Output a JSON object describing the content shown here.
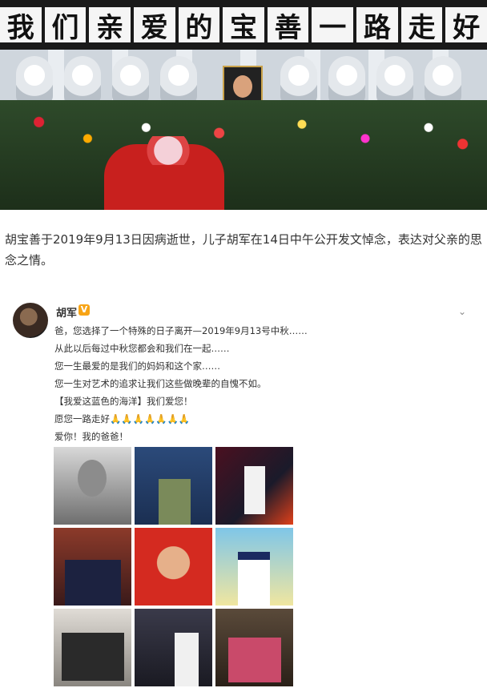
{
  "banner": {
    "chars": [
      "我",
      "们",
      "亲",
      "爱",
      "的",
      "宝",
      "善",
      "一",
      "路",
      "走",
      "好"
    ]
  },
  "caption": {
    "text": "胡宝善于2019年9月13日因病逝世，儿子胡军在14日中午公开发文悼念，表达对父亲的思念之情。"
  },
  "post": {
    "username": "胡军",
    "verified_badge": "V",
    "lines": [
      "爸，您选择了一个特殊的日子离开—2019年9月13号中秋……",
      "从此以后每过中秋您都会和我们在一起……",
      "您一生最爱的是我们的妈妈和这个家……",
      "您一生对艺术的追求让我们这些做晚辈的自愧不如。",
      "【我爱这蓝色的海洋】我们爱您！",
      "愿您一路走好",
      "爱你！我的爸爸！"
    ],
    "pray_emojis": "🙏🙏🙏🙏🙏🙏🙏",
    "photo_count": 9
  },
  "icons": {
    "expand": "chevron-down-icon",
    "verified": "verified-badge-icon"
  },
  "colors": {
    "badge": "#f7a416",
    "banner_bg": "#1a1a1a"
  }
}
